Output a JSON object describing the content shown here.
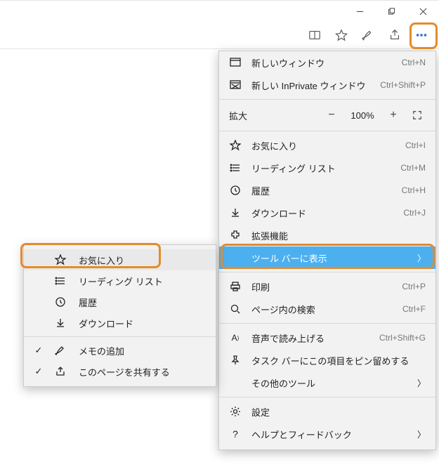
{
  "titlebar": {
    "minimize": "—",
    "maximize": "❐",
    "close": "✕"
  },
  "toolbar": {
    "reading": "reading-view",
    "favorite": "star",
    "pen": "pen",
    "share": "share",
    "more": "more"
  },
  "menu": {
    "newWindow": {
      "label": "新しいウィンドウ",
      "shortcut": "Ctrl+N"
    },
    "newPrivate": {
      "label": "新しい InPrivate ウィンドウ",
      "shortcut": "Ctrl+Shift+P"
    },
    "zoom": {
      "label": "拡大",
      "value": "100%"
    },
    "favorites": {
      "label": "お気に入り",
      "shortcut": "Ctrl+I"
    },
    "readingList": {
      "label": "リーディング リスト",
      "shortcut": "Ctrl+M"
    },
    "history": {
      "label": "履歴",
      "shortcut": "Ctrl+H"
    },
    "downloads": {
      "label": "ダウンロード",
      "shortcut": "Ctrl+J"
    },
    "extensions": {
      "label": "拡張機能"
    },
    "showInToolbar": {
      "label": "ツール バーに表示"
    },
    "print": {
      "label": "印刷",
      "shortcut": "Ctrl+P"
    },
    "find": {
      "label": "ページ内の検索",
      "shortcut": "Ctrl+F"
    },
    "readAloud": {
      "label": "音声で読み上げる",
      "shortcut": "Ctrl+Shift+G"
    },
    "pinTaskbar": {
      "label": "タスク バーにこの項目をピン留めする"
    },
    "moreTools": {
      "label": "その他のツール"
    },
    "settings": {
      "label": "設定"
    },
    "help": {
      "label": "ヘルプとフィードバック"
    }
  },
  "submenu": {
    "favorites": {
      "label": "お気に入り"
    },
    "readingList": {
      "label": "リーディング リスト"
    },
    "history": {
      "label": "履歴"
    },
    "downloads": {
      "label": "ダウンロード"
    },
    "addNote": {
      "label": "メモの追加",
      "checked": true
    },
    "sharePage": {
      "label": "このページを共有する",
      "checked": true
    }
  }
}
